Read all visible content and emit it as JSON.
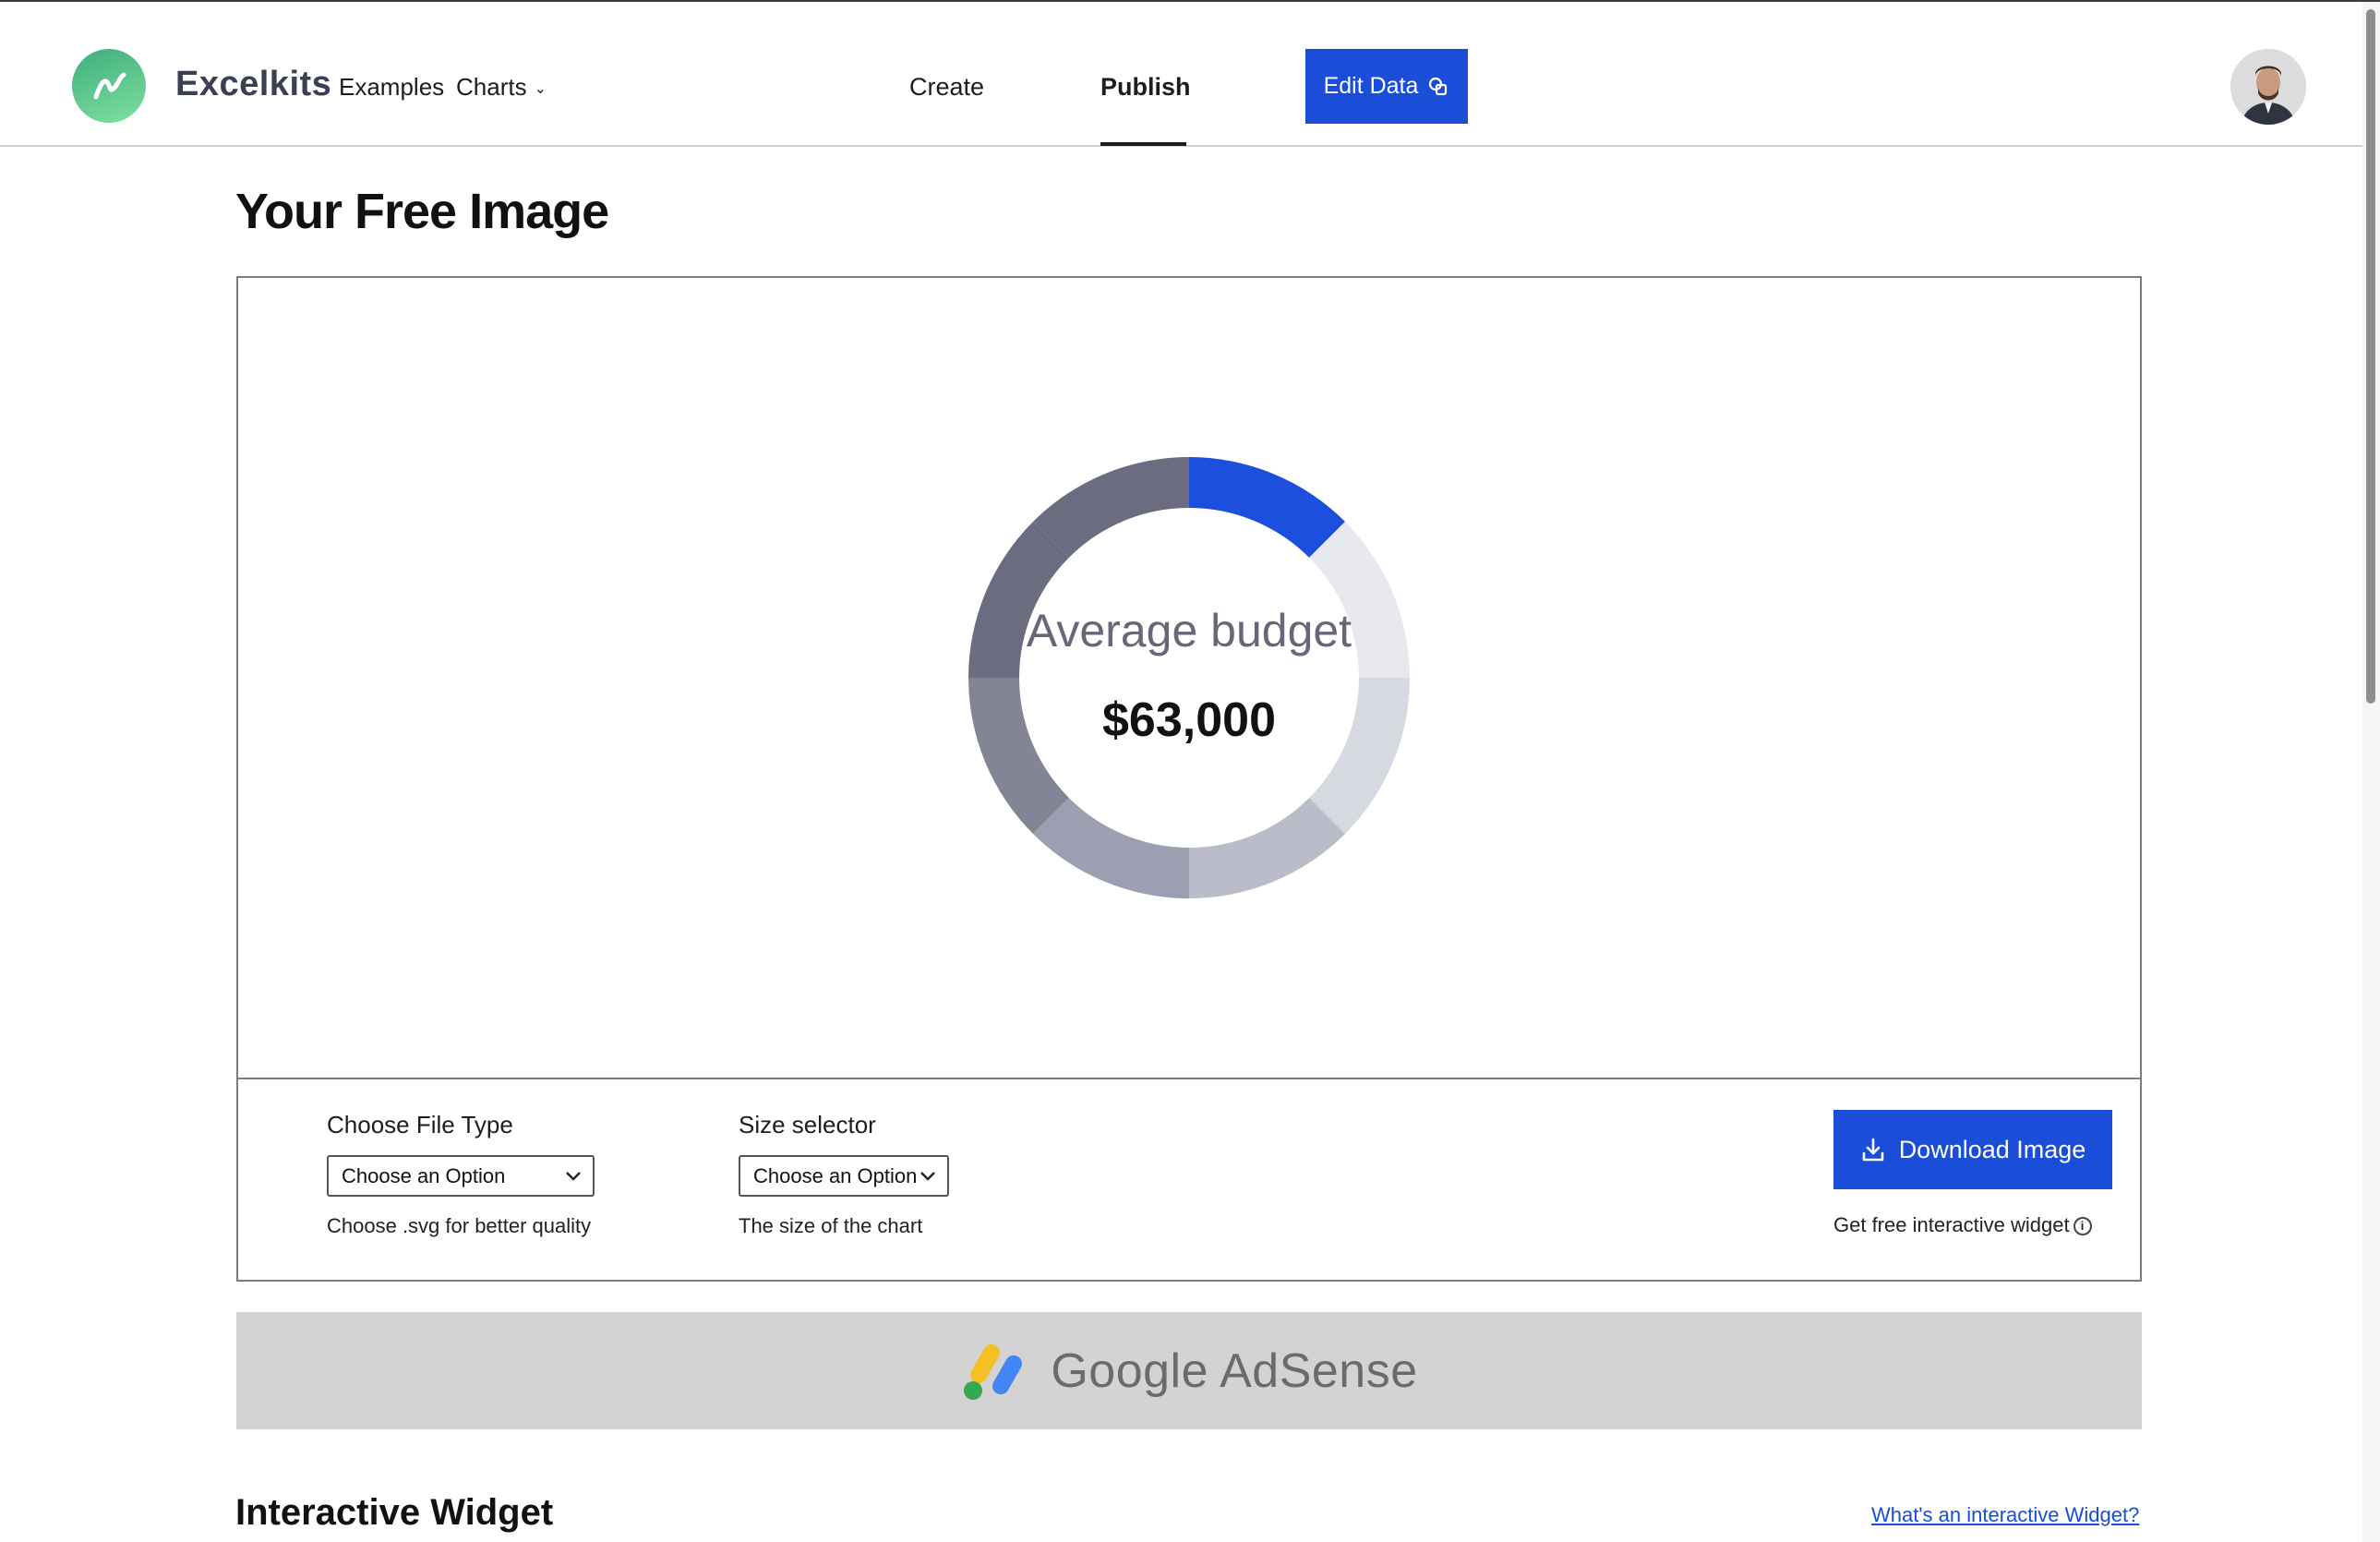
{
  "header": {
    "brand": "Excelkits",
    "nav": {
      "examples": "Examples",
      "charts": "Charts"
    },
    "tabs": {
      "create": "Create",
      "publish": "Publish"
    },
    "edit_data_label": "Edit Data"
  },
  "main": {
    "title": "Your Free Image",
    "controls": {
      "file_type": {
        "label": "Choose File Type",
        "selected": "Choose an Option",
        "hint": "Choose .svg for better quality"
      },
      "size": {
        "label": "Size selector",
        "selected": "Choose an Option",
        "hint": "The size of the chart"
      },
      "download_label": "Download Image",
      "widget_note": "Get free interactive widget"
    },
    "ad_text": "Google AdSense",
    "section_title": "Interactive Widget",
    "widget_link": "What's an interactive Widget?"
  },
  "chart_data": {
    "type": "pie",
    "center_label": "Average budget",
    "center_value": "$63,000",
    "donut": true,
    "values": [
      12.5,
      12.5,
      12.5,
      12.5,
      12.5,
      12.5,
      12.5,
      12.5
    ],
    "colors": [
      "#1c4fdd",
      "#e8e9ee",
      "#d7d9e1",
      "#babcca",
      "#9c9eb1",
      "#838596",
      "#6b6c7f",
      "#6b6c7f"
    ]
  },
  "colors": {
    "accent": "#1a4ed8",
    "brand_green": "#3fae7a"
  }
}
